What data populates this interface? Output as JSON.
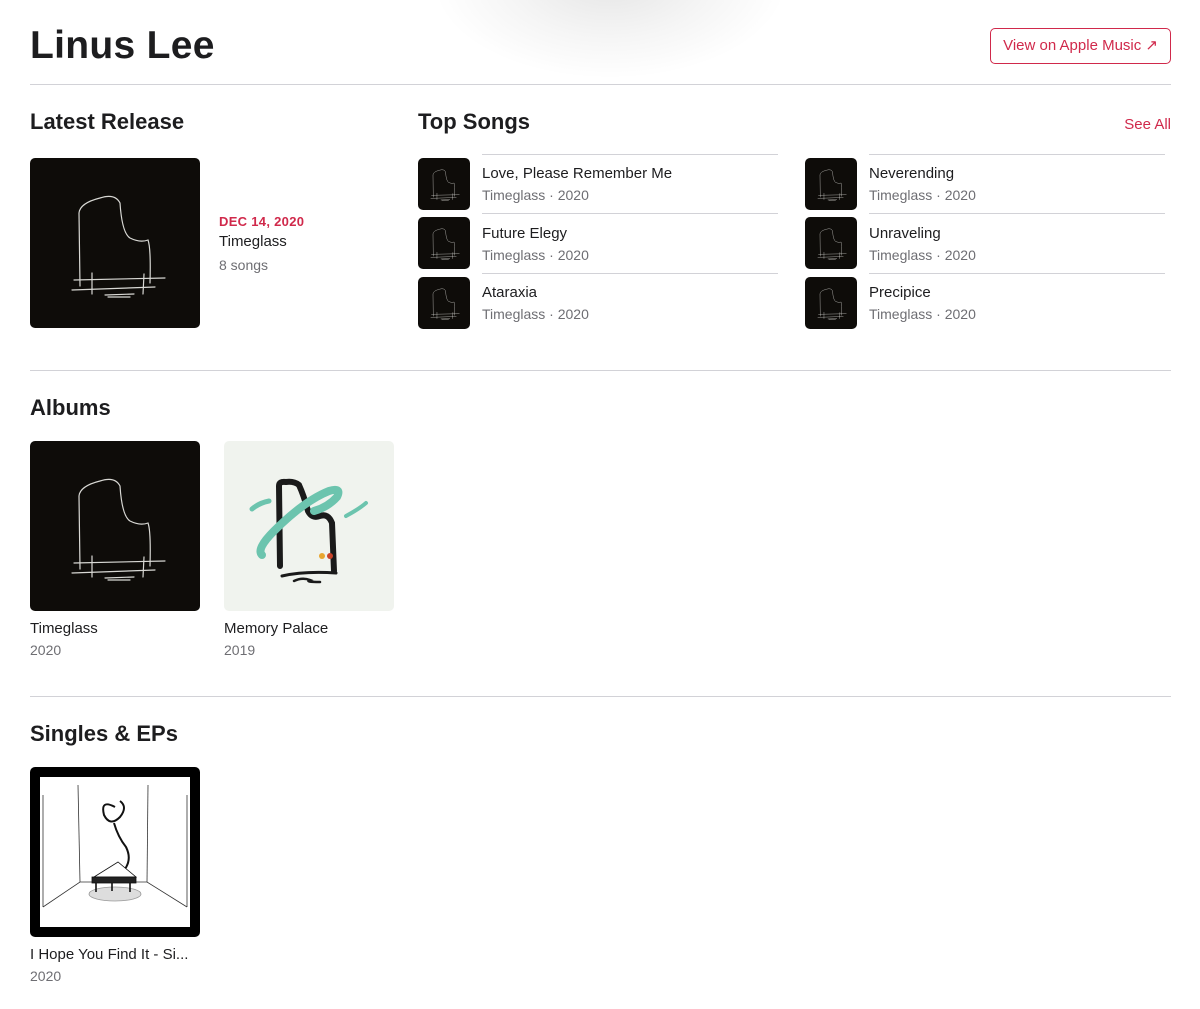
{
  "header": {
    "artist_name": "Linus Lee",
    "view_button_prefix": "View on ",
    "view_button_brand": "Apple Music",
    "view_button_icon": "↗"
  },
  "latest_release": {
    "section_title": "Latest Release",
    "date": "DEC 14, 2020",
    "title": "Timeglass",
    "song_count": "8 songs"
  },
  "top_songs": {
    "section_title": "Top Songs",
    "see_all_label": "See All",
    "songs": [
      {
        "title": "Love, Please Remember Me",
        "subtitle": "Timeglass · 2020"
      },
      {
        "title": "Neverending",
        "subtitle": "Timeglass · 2020"
      },
      {
        "title": "Future Elegy",
        "subtitle": "Timeglass · 2020"
      },
      {
        "title": "Unraveling",
        "subtitle": "Timeglass · 2020"
      },
      {
        "title": "Ataraxia",
        "subtitle": "Timeglass · 2020"
      },
      {
        "title": "Precipice",
        "subtitle": "Timeglass · 2020"
      }
    ]
  },
  "albums": {
    "section_title": "Albums",
    "items": [
      {
        "title": "Timeglass",
        "year": "2020"
      },
      {
        "title": "Memory Palace",
        "year": "2019"
      }
    ]
  },
  "singles": {
    "section_title": "Singles & EPs",
    "items": [
      {
        "title": "I Hope You Find It - Si...",
        "year": "2020"
      }
    ]
  },
  "colors": {
    "accent": "#d0294b",
    "text_primary": "#1d1d1f",
    "text_secondary": "#6e6e73",
    "divider": "#d2d2d7"
  }
}
